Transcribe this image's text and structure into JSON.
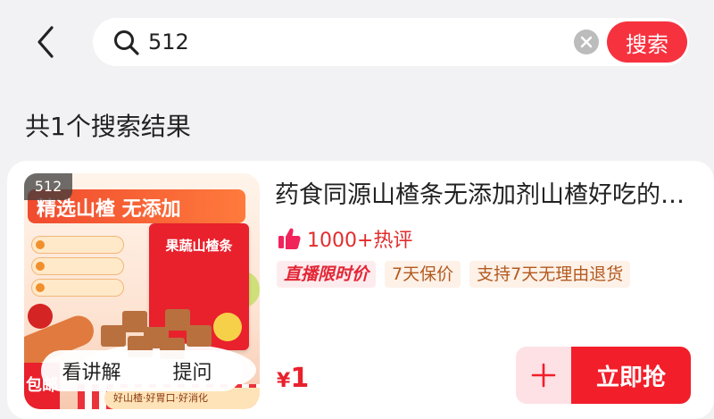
{
  "search": {
    "query": "512",
    "button_label": "搜索"
  },
  "results": {
    "count_text": "共1个搜索结果"
  },
  "product": {
    "badge": "512",
    "image_text": {
      "banner": "精选山楂 无添加",
      "pack_title": "果蔬山楂条",
      "bottom_tag": "好山楂·好胃口·好消化",
      "corner": "包邮"
    },
    "media_actions": [
      "看讲解",
      "提问"
    ],
    "title": "药食同源山楂条无添加剂山楂好吃的零食",
    "reviews": "1000+热评",
    "tags": [
      "直播限时价",
      "7天保价",
      "支持7天无理由退货"
    ],
    "price_currency": "¥",
    "price_value": "1",
    "buy_label": "立即抢"
  },
  "colors": {
    "accent": "#f21e2a",
    "page_bg": "#f2f2f4"
  },
  "icons": {
    "back": "chevron-left-icon",
    "search": "search-icon",
    "clear": "clear-icon",
    "reviews": "thumbs-up-icon",
    "add_cart": "plus-icon"
  }
}
